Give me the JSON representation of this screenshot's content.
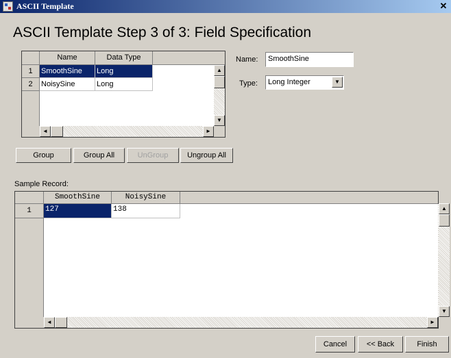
{
  "window": {
    "title": "ASCII Template"
  },
  "heading": "ASCII Template Step 3 of 3:  Field Specification",
  "fields_grid": {
    "columns": [
      "Name",
      "Data Type"
    ],
    "rows": [
      {
        "num": "1",
        "name": "SmoothSine",
        "type": "Long"
      },
      {
        "num": "2",
        "name": "NoisySine",
        "type": "Long"
      }
    ]
  },
  "name_field": {
    "label": "Name:",
    "value": "SmoothSine"
  },
  "type_field": {
    "label": "Type:",
    "value": "Long Integer"
  },
  "buttons": {
    "group": "Group",
    "group_all": "Group All",
    "ungroup": "UnGroup",
    "ungroup_all": "Ungroup All",
    "cancel": "Cancel",
    "back": "<< Back",
    "finish": "Finish"
  },
  "sample": {
    "label": "Sample Record:",
    "columns": [
      "SmoothSine",
      "NoisySine"
    ],
    "row_num": "1",
    "values": [
      "127",
      "138"
    ]
  },
  "icons": {
    "close": "close-icon",
    "scroll_up": "up-arrow-icon",
    "scroll_down": "down-arrow-icon",
    "scroll_left": "left-arrow-icon",
    "scroll_right": "right-arrow-icon",
    "dropdown": "chevron-down-icon"
  }
}
